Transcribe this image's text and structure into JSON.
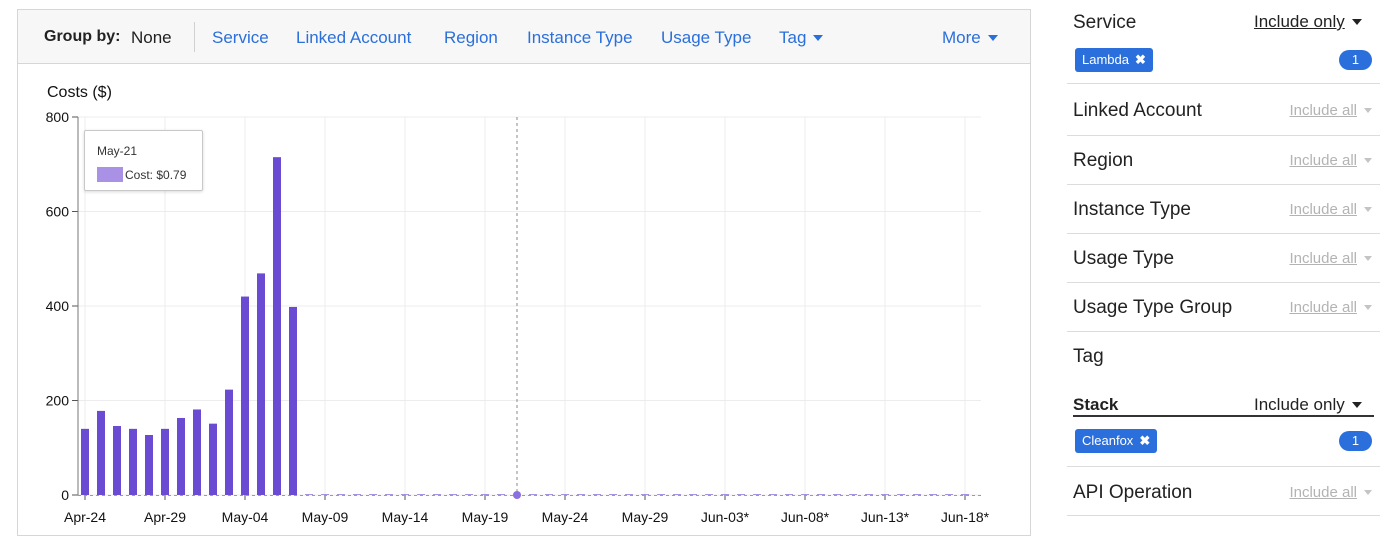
{
  "group_by": {
    "label": "Group by:",
    "value": "None",
    "options": [
      "Service",
      "Linked Account",
      "Region",
      "Instance Type",
      "Usage Type",
      "Tag"
    ],
    "more": "More"
  },
  "chart_data": {
    "type": "bar",
    "ylabel": "Costs ($)",
    "ylim": [
      0,
      800
    ],
    "yticks": [
      0,
      200,
      400,
      600,
      800
    ],
    "x_tick_labels": [
      "Apr-24",
      "Apr-29",
      "May-04",
      "May-09",
      "May-14",
      "May-19",
      "May-24",
      "May-29",
      "Jun-03*",
      "Jun-08*",
      "Jun-13*",
      "Jun-18*"
    ],
    "categories": [
      "Apr-24",
      "Apr-25",
      "Apr-26",
      "Apr-27",
      "Apr-28",
      "Apr-29",
      "Apr-30",
      "May-01",
      "May-02",
      "May-03",
      "May-04",
      "May-05",
      "May-06",
      "May-07",
      "May-08",
      "May-09",
      "May-10",
      "May-11",
      "May-12",
      "May-13",
      "May-14",
      "May-15",
      "May-16",
      "May-17",
      "May-18",
      "May-19",
      "May-20",
      "May-21",
      "May-22",
      "May-23",
      "May-24",
      "May-25",
      "May-26",
      "May-27",
      "May-28",
      "May-29",
      "May-30",
      "May-31",
      "Jun-01",
      "Jun-02",
      "Jun-03*",
      "Jun-04*",
      "Jun-05*",
      "Jun-06*",
      "Jun-07*",
      "Jun-08*",
      "Jun-09*",
      "Jun-10*",
      "Jun-11*",
      "Jun-12*",
      "Jun-13*",
      "Jun-14*",
      "Jun-15*",
      "Jun-16*",
      "Jun-17*",
      "Jun-18*"
    ],
    "values": [
      140,
      178,
      146,
      140,
      127,
      140,
      163,
      181,
      151,
      223,
      420,
      469,
      715,
      398,
      0.3,
      0.2,
      0.2,
      0.2,
      0.2,
      0.2,
      0.2,
      0.2,
      0.2,
      0.2,
      0.2,
      0.2,
      0.2,
      0.79,
      0.2,
      0.2,
      0.2,
      0.2,
      0.2,
      0.2,
      0.2,
      0.2,
      0.2,
      0.2,
      0.2,
      0.2,
      0.2,
      0.2,
      0.2,
      0.2,
      0.2,
      0.2,
      0.2,
      0.2,
      0.2,
      0.2,
      0.2,
      0.2,
      0.2,
      0.2,
      0.2,
      0.2
    ],
    "highlight_category": "May-21",
    "bar_color": "#6a4bd1",
    "grid": true,
    "tooltip": {
      "title": "May-21",
      "text": "Cost: $0.79",
      "swatch_color": "#a992e6"
    }
  },
  "filters": {
    "service": {
      "label": "Service",
      "mode": "Include only",
      "chip": "Lambda",
      "count": "1"
    },
    "linked_account": {
      "label": "Linked Account",
      "mode": "Include all"
    },
    "region": {
      "label": "Region",
      "mode": "Include all"
    },
    "instance_type": {
      "label": "Instance Type",
      "mode": "Include all"
    },
    "usage_type": {
      "label": "Usage Type",
      "mode": "Include all"
    },
    "usage_type_group": {
      "label": "Usage Type Group",
      "mode": "Include all"
    },
    "tag": {
      "label": "Tag"
    },
    "stack": {
      "label": "Stack",
      "mode": "Include only",
      "chip": "Cleanfox",
      "count": "1"
    },
    "api_operation": {
      "label": "API Operation",
      "mode": "Include all"
    }
  },
  "colors": {
    "accent": "#2a6fdb",
    "bar": "#6a4bd1",
    "muted": "#b3b3b3"
  }
}
